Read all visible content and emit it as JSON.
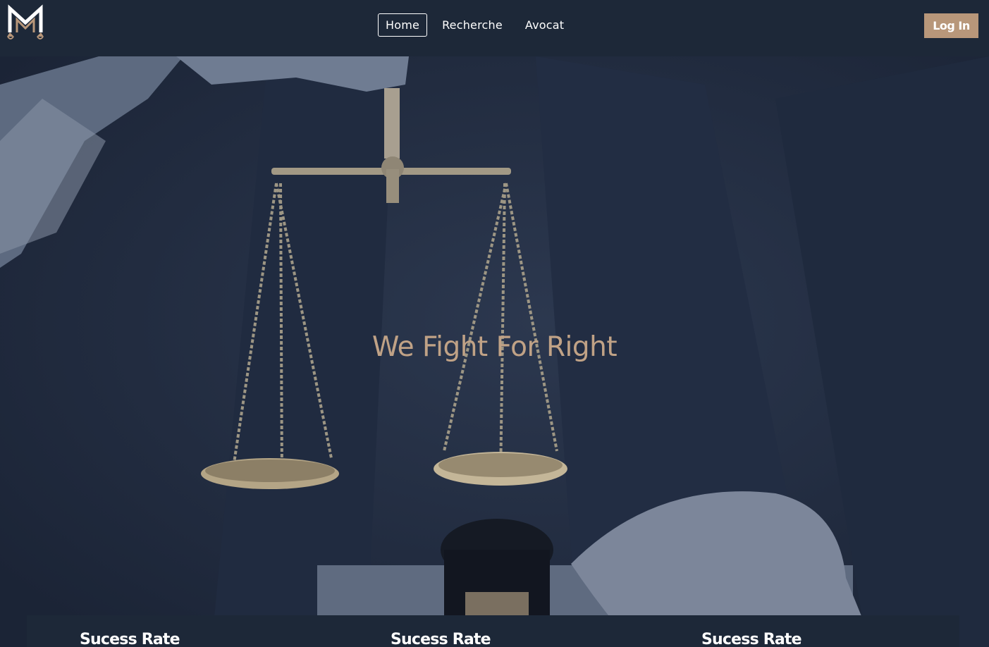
{
  "nav": {
    "links": [
      {
        "label": "Home",
        "active": true
      },
      {
        "label": "Recherche",
        "active": false
      },
      {
        "label": "Avocat",
        "active": false
      }
    ],
    "login_label": "Log In"
  },
  "hero": {
    "title": "We Fight For Right"
  },
  "cards": [
    {
      "title": "Sucess Rate"
    },
    {
      "title": "Sucess Rate"
    },
    {
      "title": "Sucess Rate"
    }
  ],
  "colors": {
    "navbar": "#1d2838",
    "accent": "#b8977a",
    "hero_title": "#c0a286",
    "hero_overlay": "#26324a"
  },
  "icons": {
    "logo": "law-scales-m-logo-icon"
  }
}
